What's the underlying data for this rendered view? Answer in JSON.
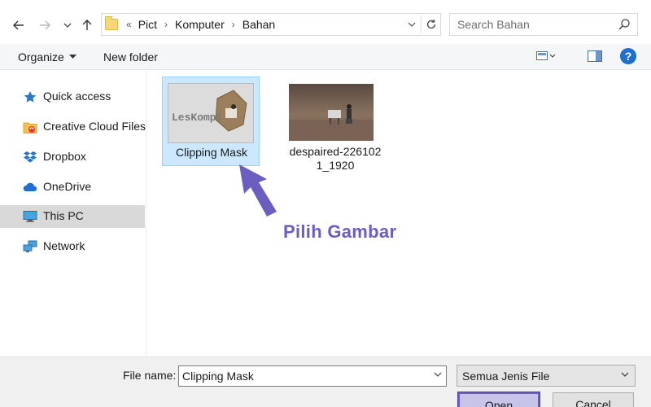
{
  "address": {
    "overflow": "«",
    "crumbs": [
      "Pict",
      "Komputer",
      "Bahan"
    ]
  },
  "search": {
    "placeholder": "Search Bahan"
  },
  "toolbar": {
    "organize_label": "Organize",
    "new_folder_label": "New folder",
    "help_label": "?"
  },
  "nav": {
    "items": [
      {
        "label": "Quick access",
        "icon": "star-icon"
      },
      {
        "label": "Creative Cloud Files",
        "icon": "creative-cloud-icon"
      },
      {
        "label": "Dropbox",
        "icon": "dropbox-icon"
      },
      {
        "label": "OneDrive",
        "icon": "cloud-icon"
      },
      {
        "label": "This PC",
        "icon": "monitor-icon",
        "selected": true
      },
      {
        "label": "Network",
        "icon": "network-icon"
      }
    ]
  },
  "files": [
    {
      "name": "Clipping Mask",
      "selected": true,
      "thumb_text": "LesKompi"
    },
    {
      "name_line1": "despaired-226102",
      "name_line2": "1_1920",
      "selected": false
    }
  ],
  "annotation": {
    "text": "Pilih Gambar",
    "color": "#6a5fc1"
  },
  "bottom": {
    "filename_label": "File name:",
    "filename_value": "Clipping Mask",
    "filetype_value": "Semua Jenis File",
    "open_label": "Open",
    "cancel_label": "Cancel"
  },
  "colors": {
    "accent": "#1f6fd1",
    "selection": "#cce8ff",
    "highlight": "#6a5fc1"
  }
}
